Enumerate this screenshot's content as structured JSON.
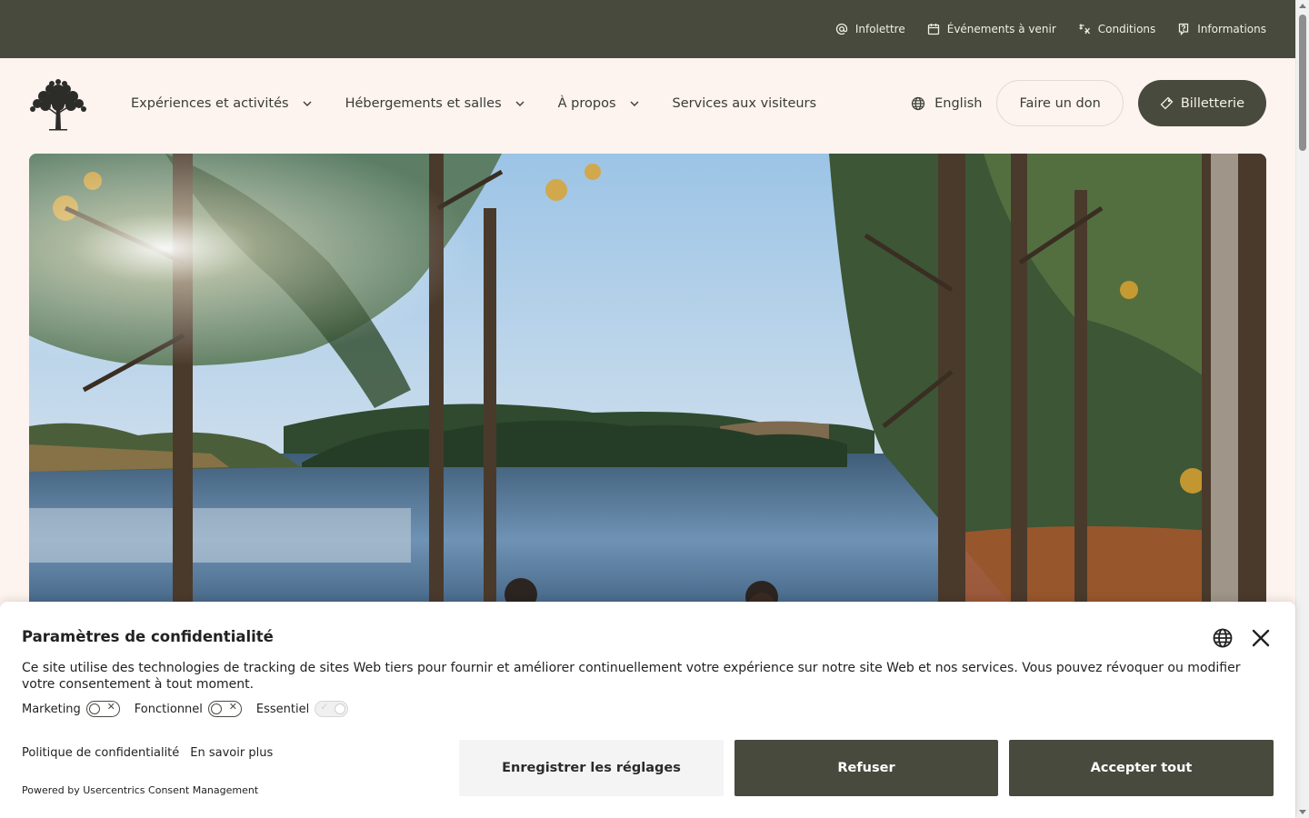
{
  "topbar": {
    "links": [
      {
        "label": "Infolettre",
        "icon": "at-icon"
      },
      {
        "label": "Événements à venir",
        "icon": "calendar-icon"
      },
      {
        "label": "Conditions",
        "icon": "conditions-icon"
      },
      {
        "label": "Informations",
        "icon": "info-icon"
      }
    ]
  },
  "header": {
    "nav": [
      {
        "label": "Expériences et activités",
        "has_dropdown": true
      },
      {
        "label": "Hébergements et salles",
        "has_dropdown": true
      },
      {
        "label": "À propos",
        "has_dropdown": true
      },
      {
        "label": "Services aux visiteurs",
        "has_dropdown": false
      }
    ],
    "language": "English",
    "donate_label": "Faire un don",
    "tickets_label": "Billetterie"
  },
  "consent": {
    "title": "Paramètres de confidentialité",
    "description": "Ce site utilise des technologies de tracking de sites Web tiers pour fournir et améliorer continuellement votre expérience sur notre site Web et nos services. Vous pouvez révoquer ou modifier votre consentement à tout moment.",
    "toggles": [
      {
        "label": "Marketing",
        "enabled": false,
        "disabled": false
      },
      {
        "label": "Fonctionnel",
        "enabled": false,
        "disabled": false
      },
      {
        "label": "Essentiel",
        "enabled": true,
        "disabled": true
      }
    ],
    "privacy_link": "Politique de confidentialité",
    "learn_more_link": "En savoir plus",
    "powered_by": "Powered by Usercentrics Consent Management",
    "save_label": "Enregistrer les réglages",
    "refuse_label": "Refuser",
    "accept_label": "Accepter tout"
  },
  "colors": {
    "brand_dark": "#474a3d",
    "page_bg": "#fdf3ef"
  }
}
